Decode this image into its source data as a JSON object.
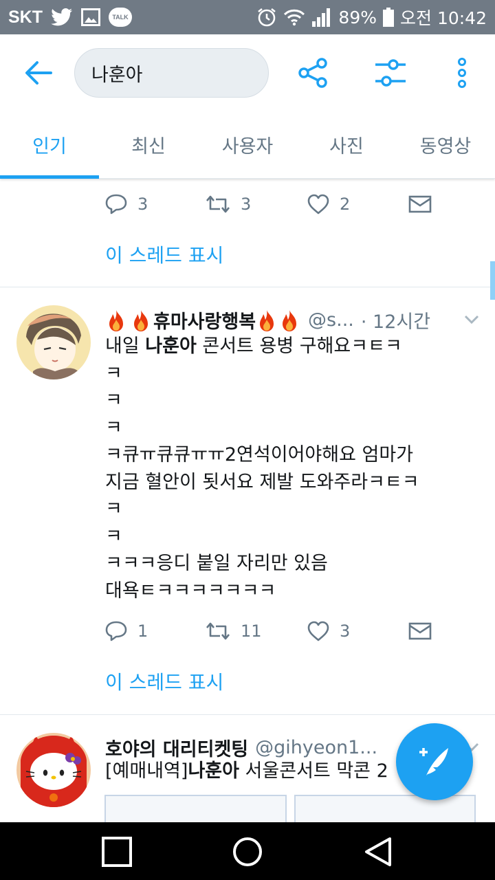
{
  "status_bar": {
    "carrier": "SKT",
    "talk_label": "TALK",
    "battery": "89%",
    "time": "오전 10:42"
  },
  "search": {
    "query": "나훈아"
  },
  "tabs": [
    {
      "label": "인기",
      "active": true
    },
    {
      "label": "최신"
    },
    {
      "label": "사용자"
    },
    {
      "label": "사진"
    },
    {
      "label": "동영상"
    }
  ],
  "prev_tweet": {
    "replies": "3",
    "retweets": "3",
    "likes": "2",
    "thread_link": "이 스레드 표시"
  },
  "tweet1": {
    "display_name": "휴마사랑행복",
    "handle": "@s...",
    "time": "· 12시간",
    "lines": [
      {
        "pre": "내일 ",
        "bold": "나훈아",
        "post": " 콘서트 용병 구해요ㅋㅌㅋ"
      },
      {
        "pre": "ㅋ"
      },
      {
        "pre": "ㅋ"
      },
      {
        "pre": "ㅋ"
      },
      {
        "pre": "ㅋ큐ㅠ큐큐ㅠㅠ2연석이어야해요 엄마가"
      },
      {
        "pre": "지금 혈안이 됫서요 제발 도와주라ㅋㅌㅋ"
      },
      {
        "pre": "ㅋ"
      },
      {
        "pre": "ㅋ"
      },
      {
        "pre": "ㅋㅋㅋ응디 붙일 자리만 있음"
      },
      {
        "pre": "대욕ㅌㅋㅋㅋㅋㅋㅋㅋ"
      }
    ],
    "replies": "1",
    "retweets": "11",
    "likes": "3",
    "thread_link": "이 스레드 표시"
  },
  "tweet2": {
    "display_name": "호야의 대리티켓팅",
    "handle": "@gihyeon1...",
    "text_pre": "[예매내역]",
    "text_bold": "나훈아",
    "text_post": " 서울콘서트 막콘 2"
  },
  "colors": {
    "accent": "#1da1f2",
    "status_bar": "#707a85",
    "flame": "#e8380d"
  }
}
